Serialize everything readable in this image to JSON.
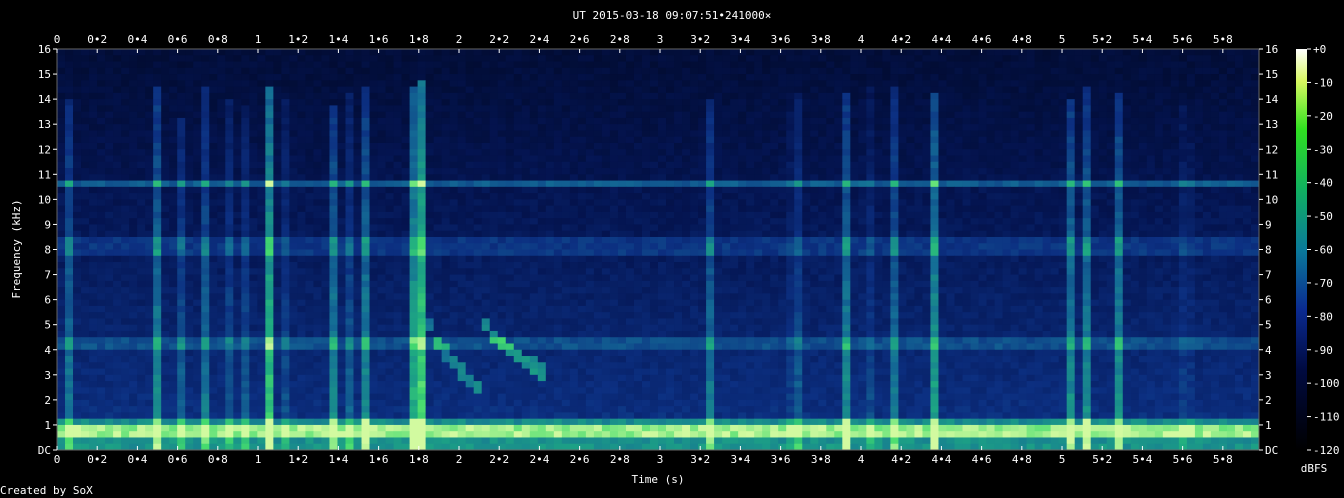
{
  "chart_data": {
    "type": "heatmap",
    "title": "UT 2015-03-18 09:07:51•241000×",
    "xlabel": "Time (s)",
    "ylabel": "Frequency (kHz)",
    "xlim": [
      0,
      5.98
    ],
    "ylim": [
      0,
      16
    ],
    "x_ticks": [
      "0",
      "0•2",
      "0•4",
      "0•6",
      "0•8",
      "1",
      "1•2",
      "1•4",
      "1•6",
      "1•8",
      "2",
      "2•2",
      "2•4",
      "2•6",
      "2•8",
      "3",
      "3•2",
      "3•4",
      "3•6",
      "3•8",
      "4",
      "4•2",
      "4•4",
      "4•6",
      "4•8",
      "5",
      "5•2",
      "5•4",
      "5•6",
      "5•8"
    ],
    "y_ticks": [
      "DC",
      "1",
      "2",
      "3",
      "4",
      "5",
      "6",
      "7",
      "8",
      "9",
      "10",
      "11",
      "12",
      "13",
      "14",
      "15",
      "16"
    ],
    "colorbar": {
      "label": "dBFS",
      "ticks": [
        "+0",
        "-10",
        "-20",
        "-30",
        "-40",
        "-50",
        "-60",
        "-70",
        "-80",
        "-90",
        "-100",
        "-110",
        "-120"
      ],
      "range": [
        -120,
        0
      ]
    },
    "grid": false,
    "features": {
      "horizontal_bands_khz": [
        10.6,
        8.4,
        8.0,
        4.2,
        0.3,
        0.6,
        0.8,
        1.0
      ],
      "vertical_events": [
        {
          "t": 0.07,
          "f_max": 14.0,
          "level": 0.55
        },
        {
          "t": 0.49,
          "f_max": 14.4,
          "level": 0.6
        },
        {
          "t": 0.61,
          "f_max": 13.2,
          "level": 0.35
        },
        {
          "t": 0.73,
          "f_max": 14.4,
          "level": 0.45
        },
        {
          "t": 0.87,
          "f_max": 14.0,
          "level": 0.4
        },
        {
          "t": 0.95,
          "f_max": 13.8,
          "level": 0.4
        },
        {
          "t": 1.05,
          "f_max": 14.5,
          "level": 0.8
        },
        {
          "t": 1.15,
          "f_max": 14.0,
          "level": 0.35
        },
        {
          "t": 1.37,
          "f_max": 13.8,
          "level": 0.5
        },
        {
          "t": 1.47,
          "f_max": 14.3,
          "level": 0.55
        },
        {
          "t": 1.53,
          "f_max": 14.6,
          "level": 0.5
        },
        {
          "t": 1.78,
          "f_max": 14.6,
          "level": 0.7
        },
        {
          "t": 1.81,
          "f_max": 14.8,
          "level": 0.8
        },
        {
          "t": 3.24,
          "f_max": 14.0,
          "level": 0.5
        },
        {
          "t": 3.67,
          "f_max": 14.2,
          "level": 0.75
        },
        {
          "t": 3.93,
          "f_max": 14.2,
          "level": 0.45
        },
        {
          "t": 4.03,
          "f_max": 14.5,
          "level": 0.4
        },
        {
          "t": 4.18,
          "f_max": 14.6,
          "level": 0.75
        },
        {
          "t": 4.36,
          "f_max": 14.3,
          "level": 0.6
        },
        {
          "t": 5.05,
          "f_max": 14.0,
          "level": 0.55
        },
        {
          "t": 5.13,
          "f_max": 14.4,
          "level": 0.55
        },
        {
          "t": 5.29,
          "f_max": 14.2,
          "level": 0.6
        },
        {
          "t": 5.62,
          "f_max": 13.8,
          "level": 0.4
        }
      ],
      "sweeps": [
        {
          "t0": 1.83,
          "f0": 6.0,
          "t1": 2.1,
          "f1": 2.5,
          "level": 0.45
        },
        {
          "t0": 2.1,
          "f0": 5.8,
          "t1": 2.45,
          "f1": 3.0,
          "level": 0.55
        }
      ]
    }
  },
  "footer": {
    "credit": "Created by SoX"
  }
}
